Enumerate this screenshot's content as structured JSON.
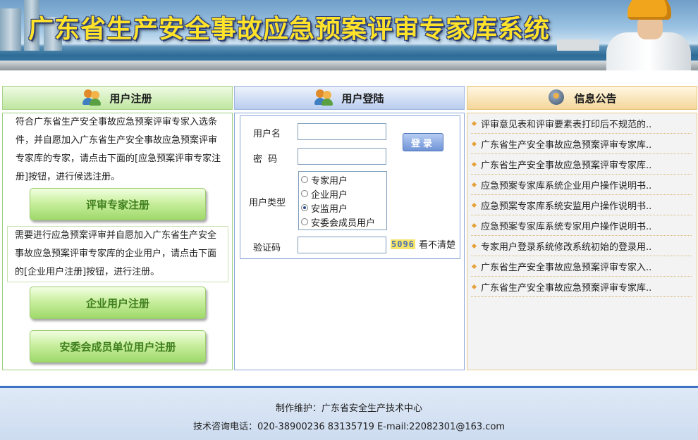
{
  "banner": {
    "title": "广东省生产安全事故应急预案评审专家库系统"
  },
  "registration": {
    "heading": "用户注册",
    "expert_text": "符合广东省生产安全事故应急预案评审专家入选条件，并自愿加入广东省生产安全事故应急预案评审专家库的专家，请点击下面的[应急预案评审专家注册]按钮，进行候选注册。",
    "expert_button": "评审专家注册",
    "company_text": "需要进行应急预案评审并自愿加入广东省生产安全事故应急预案评审专家库的企业用户，请点击下面的[企业用户注册]按钮，进行注册。",
    "company_button": "企业用户注册",
    "member_button": "安委会成员单位用户注册"
  },
  "login": {
    "heading": "用户登陆",
    "username_label": "用户名",
    "username_value": "",
    "password_label": "密 码",
    "password_value": "",
    "login_button": "登录",
    "usertype_label": "用户类型",
    "usertypes": [
      {
        "label": "专家用户",
        "selected": false
      },
      {
        "label": "企业用户",
        "selected": false
      },
      {
        "label": "安监用户",
        "selected": true
      },
      {
        "label": "安委会成员用户",
        "selected": false
      }
    ],
    "captcha_label": "验证码",
    "captcha_value": "",
    "captcha_code": "5096",
    "captcha_refresh": "看不清楚"
  },
  "notices": {
    "heading": "信息公告",
    "items": [
      "评审意见表和评审要素表打印后不规范的..",
      "广东省生产安全事故应急预案评审专家库..",
      "广东省生产安全事故应急预案评审专家库..",
      "应急预案专家库系统企业用户操作说明书..",
      "应急预案专家库系统安监用户操作说明书..",
      "应急预案专家库系统专家用户操作说明书..",
      "专家用户登录系统修改系统初始的登录用..",
      "广东省生产安全事故应急预案评审专家入..",
      "广东省生产安全事故应急预案评审专家库.."
    ]
  },
  "footer": {
    "maintainer": "制作维护：广东省安全生产技术中心",
    "contact": "技术咨询电话：020-38900236 83135719 E-mail:22082301@163.com"
  }
}
